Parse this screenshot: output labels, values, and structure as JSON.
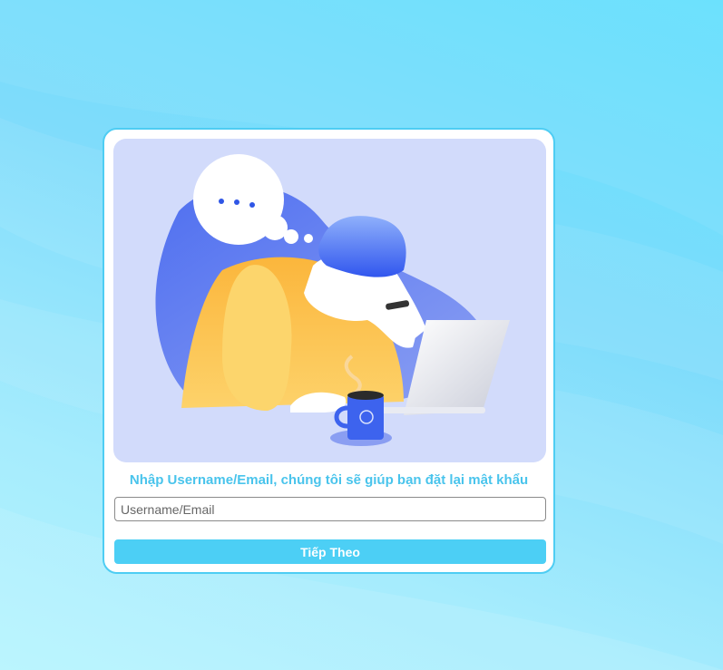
{
  "reset_form": {
    "prompt_text": "Nhập Username/Email, chúng tôi sẽ giúp bạn đặt lại mật khẩu",
    "input_placeholder": "Username/Email",
    "input_value": "",
    "submit_label": "Tiếp Theo"
  },
  "colors": {
    "accent": "#4ccff5",
    "prompt_text": "#49c4ec",
    "card_border": "#4ecdf3",
    "illustration_bg": "#d2dbfb",
    "background_top": "#63e0fd",
    "background_bottom": "#b4f4fe"
  },
  "illustration": {
    "icon": "forgot-password-illustration",
    "depicts": [
      "speech-bubble-icon",
      "person-at-laptop",
      "laptop-icon",
      "coffee-mug-icon"
    ]
  }
}
